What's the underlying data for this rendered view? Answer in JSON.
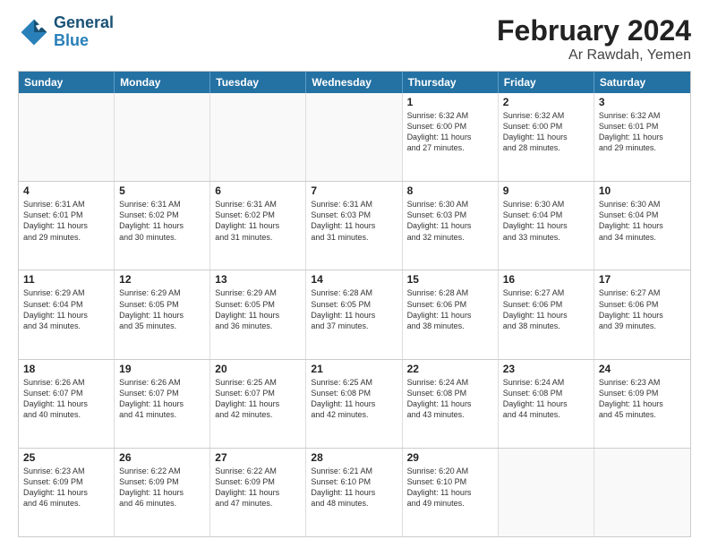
{
  "header": {
    "logo": {
      "line1": "General",
      "line2": "Blue"
    },
    "title": "February 2024",
    "subtitle": "Ar Rawdah, Yemen"
  },
  "calendar": {
    "days": [
      "Sunday",
      "Monday",
      "Tuesday",
      "Wednesday",
      "Thursday",
      "Friday",
      "Saturday"
    ],
    "rows": [
      [
        {
          "day": "",
          "info": ""
        },
        {
          "day": "",
          "info": ""
        },
        {
          "day": "",
          "info": ""
        },
        {
          "day": "",
          "info": ""
        },
        {
          "day": "1",
          "info": "Sunrise: 6:32 AM\nSunset: 6:00 PM\nDaylight: 11 hours\nand 27 minutes."
        },
        {
          "day": "2",
          "info": "Sunrise: 6:32 AM\nSunset: 6:00 PM\nDaylight: 11 hours\nand 28 minutes."
        },
        {
          "day": "3",
          "info": "Sunrise: 6:32 AM\nSunset: 6:01 PM\nDaylight: 11 hours\nand 29 minutes."
        }
      ],
      [
        {
          "day": "4",
          "info": "Sunrise: 6:31 AM\nSunset: 6:01 PM\nDaylight: 11 hours\nand 29 minutes."
        },
        {
          "day": "5",
          "info": "Sunrise: 6:31 AM\nSunset: 6:02 PM\nDaylight: 11 hours\nand 30 minutes."
        },
        {
          "day": "6",
          "info": "Sunrise: 6:31 AM\nSunset: 6:02 PM\nDaylight: 11 hours\nand 31 minutes."
        },
        {
          "day": "7",
          "info": "Sunrise: 6:31 AM\nSunset: 6:03 PM\nDaylight: 11 hours\nand 31 minutes."
        },
        {
          "day": "8",
          "info": "Sunrise: 6:30 AM\nSunset: 6:03 PM\nDaylight: 11 hours\nand 32 minutes."
        },
        {
          "day": "9",
          "info": "Sunrise: 6:30 AM\nSunset: 6:04 PM\nDaylight: 11 hours\nand 33 minutes."
        },
        {
          "day": "10",
          "info": "Sunrise: 6:30 AM\nSunset: 6:04 PM\nDaylight: 11 hours\nand 34 minutes."
        }
      ],
      [
        {
          "day": "11",
          "info": "Sunrise: 6:29 AM\nSunset: 6:04 PM\nDaylight: 11 hours\nand 34 minutes."
        },
        {
          "day": "12",
          "info": "Sunrise: 6:29 AM\nSunset: 6:05 PM\nDaylight: 11 hours\nand 35 minutes."
        },
        {
          "day": "13",
          "info": "Sunrise: 6:29 AM\nSunset: 6:05 PM\nDaylight: 11 hours\nand 36 minutes."
        },
        {
          "day": "14",
          "info": "Sunrise: 6:28 AM\nSunset: 6:05 PM\nDaylight: 11 hours\nand 37 minutes."
        },
        {
          "day": "15",
          "info": "Sunrise: 6:28 AM\nSunset: 6:06 PM\nDaylight: 11 hours\nand 38 minutes."
        },
        {
          "day": "16",
          "info": "Sunrise: 6:27 AM\nSunset: 6:06 PM\nDaylight: 11 hours\nand 38 minutes."
        },
        {
          "day": "17",
          "info": "Sunrise: 6:27 AM\nSunset: 6:06 PM\nDaylight: 11 hours\nand 39 minutes."
        }
      ],
      [
        {
          "day": "18",
          "info": "Sunrise: 6:26 AM\nSunset: 6:07 PM\nDaylight: 11 hours\nand 40 minutes."
        },
        {
          "day": "19",
          "info": "Sunrise: 6:26 AM\nSunset: 6:07 PM\nDaylight: 11 hours\nand 41 minutes."
        },
        {
          "day": "20",
          "info": "Sunrise: 6:25 AM\nSunset: 6:07 PM\nDaylight: 11 hours\nand 42 minutes."
        },
        {
          "day": "21",
          "info": "Sunrise: 6:25 AM\nSunset: 6:08 PM\nDaylight: 11 hours\nand 42 minutes."
        },
        {
          "day": "22",
          "info": "Sunrise: 6:24 AM\nSunset: 6:08 PM\nDaylight: 11 hours\nand 43 minutes."
        },
        {
          "day": "23",
          "info": "Sunrise: 6:24 AM\nSunset: 6:08 PM\nDaylight: 11 hours\nand 44 minutes."
        },
        {
          "day": "24",
          "info": "Sunrise: 6:23 AM\nSunset: 6:09 PM\nDaylight: 11 hours\nand 45 minutes."
        }
      ],
      [
        {
          "day": "25",
          "info": "Sunrise: 6:23 AM\nSunset: 6:09 PM\nDaylight: 11 hours\nand 46 minutes."
        },
        {
          "day": "26",
          "info": "Sunrise: 6:22 AM\nSunset: 6:09 PM\nDaylight: 11 hours\nand 46 minutes."
        },
        {
          "day": "27",
          "info": "Sunrise: 6:22 AM\nSunset: 6:09 PM\nDaylight: 11 hours\nand 47 minutes."
        },
        {
          "day": "28",
          "info": "Sunrise: 6:21 AM\nSunset: 6:10 PM\nDaylight: 11 hours\nand 48 minutes."
        },
        {
          "day": "29",
          "info": "Sunrise: 6:20 AM\nSunset: 6:10 PM\nDaylight: 11 hours\nand 49 minutes."
        },
        {
          "day": "",
          "info": ""
        },
        {
          "day": "",
          "info": ""
        }
      ]
    ]
  }
}
